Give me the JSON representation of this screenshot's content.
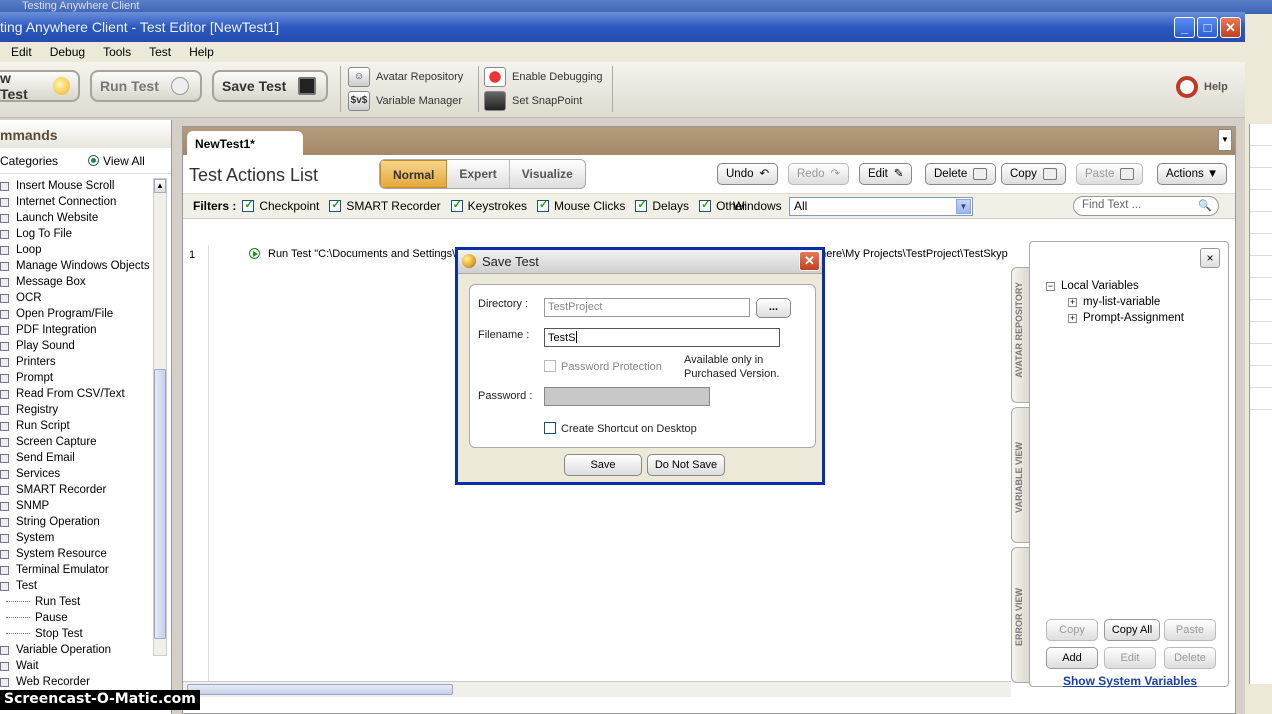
{
  "background": {
    "title_fragment": "Testing Anywhere Client"
  },
  "window": {
    "title": "ting Anywhere Client - Test Editor [NewTest1]",
    "buttons": {
      "minimize": "_",
      "maximize": "□",
      "close": "✕"
    }
  },
  "menu": [
    "Edit",
    "Debug",
    "Tools",
    "Test",
    "Help"
  ],
  "toolbar": {
    "new_test": "w Test",
    "run_test": "Run Test",
    "save_test": "Save Test",
    "avatar_repository": "Avatar Repository",
    "variable_manager": "Variable Manager",
    "variable_icon": "$v$",
    "enable_debugging": "Enable Debugging",
    "set_snappoint": "Set SnapPoint",
    "help": "Help"
  },
  "commands": {
    "header": "mmands",
    "categories": "Categories",
    "view_all": "View All",
    "items": [
      "Insert Mouse Scroll",
      "Internet Connection",
      "Launch Website",
      "Log To File",
      "Loop",
      "Manage Windows Objects",
      "Message Box",
      "OCR",
      "Open Program/File",
      "PDF Integration",
      "Play Sound",
      "Printers",
      "Prompt",
      "Read From CSV/Text",
      "Registry",
      "Run Script",
      "Screen Capture",
      "Send Email",
      "Services",
      "SMART Recorder",
      "SNMP",
      "String Operation",
      "System",
      "System Resource",
      "Terminal Emulator",
      "Test"
    ],
    "sub_items": [
      "Run Test",
      "Pause",
      "Stop Test"
    ],
    "after_items": [
      "Variable Operation",
      "Wait",
      "Web Recorder"
    ]
  },
  "editor": {
    "tab": "NewTest1*",
    "tab_dropdown": "▼",
    "title": "Test Actions List",
    "modes": [
      "Normal",
      "Expert",
      "Visualize"
    ],
    "active_mode": "Normal",
    "actions": {
      "undo": "Undo",
      "redo": "Redo",
      "edit": "Edit",
      "delete": "Delete",
      "copy": "Copy",
      "paste": "Paste",
      "actions": "Actions ▼"
    },
    "filters_label": "Filters :",
    "filters": [
      "Checkpoint",
      "SMART Recorder",
      "Keystrokes",
      "Mouse Clicks",
      "Delays",
      "Other"
    ],
    "windows_label": "Windows",
    "windows_value": "All",
    "dropdown_arrow": "▼",
    "find_placeholder": "Find Text ...",
    "find_icon": "🔍",
    "rows": [
      {
        "line": "1",
        "text": "Run Test \"C:\\Documents and Settings\\sadika.SOFTLOGICA\\My Documents\\Testing Anywhere Files\\Testing Anywhere\\My Projects\\TestProject\\TestSkyp"
      }
    ]
  },
  "side_tabs": [
    "AVATAR REPOSITORY",
    "VARIABLE VIEW",
    "ERROR VIEW"
  ],
  "variables": {
    "close": "×",
    "root": "Local Variables",
    "children": [
      "my-list-variable",
      "Prompt-Assignment"
    ],
    "expander_root": "−",
    "expander_child": "+",
    "buttons": {
      "copy": "Copy",
      "copy_all": "Copy All",
      "paste": "Paste",
      "add": "Add",
      "edit": "Edit",
      "delete": "Delete"
    },
    "show_system": "Show System Variables"
  },
  "dialog": {
    "title": "Save Test",
    "close": "✕",
    "directory_label": "Directory :",
    "directory_value": "TestProject",
    "browse": "...",
    "filename_label": "Filename :",
    "filename_value": "TestS",
    "password_protection": "Password Protection",
    "available_note_1": "Available only in",
    "available_note_2": "Purchased Version.",
    "password_label": "Password :",
    "shortcut": "Create Shortcut on Desktop",
    "save": "Save",
    "do_not_save": "Do Not Save"
  },
  "watermark": "Screencast-O-Matic.com"
}
